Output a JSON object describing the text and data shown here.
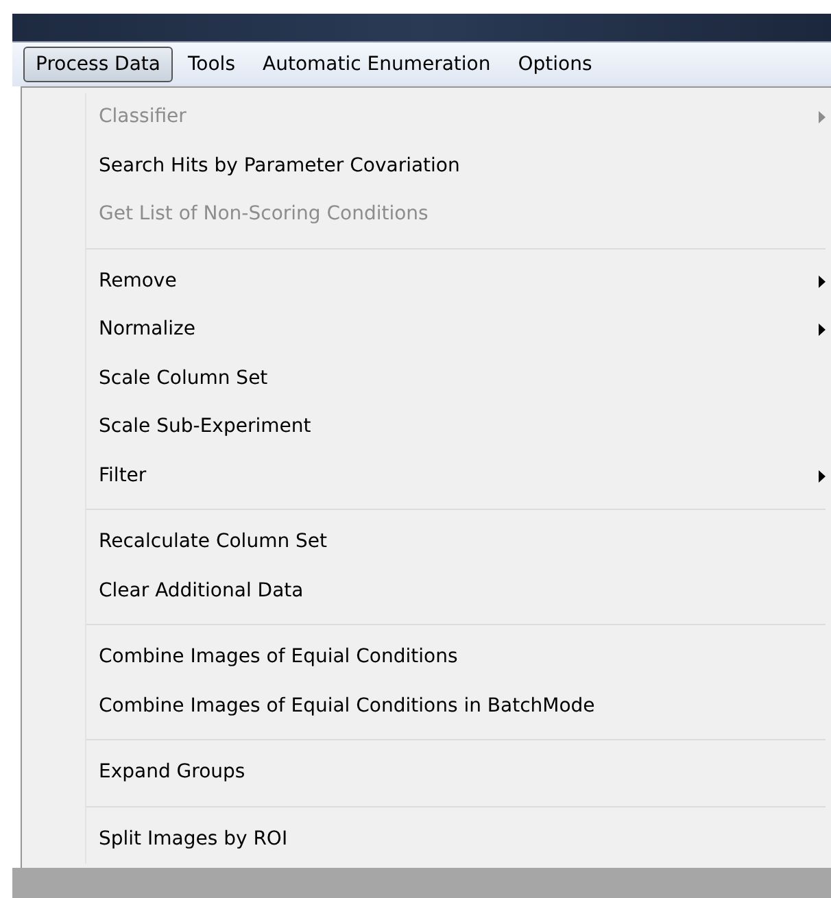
{
  "menubar": [
    {
      "label": "Process Data",
      "selected": true
    },
    {
      "label": "Tools",
      "selected": false
    },
    {
      "label": "Automatic Enumeration",
      "selected": false
    },
    {
      "label": "Options",
      "selected": false
    }
  ],
  "menu": {
    "groups": [
      {
        "items": [
          {
            "label": "Classifier",
            "disabled": true,
            "submenu": true
          },
          {
            "label": "Search Hits by Parameter Covariation",
            "disabled": false,
            "submenu": false
          },
          {
            "label": "Get List of Non-Scoring Conditions",
            "disabled": true,
            "submenu": false
          }
        ]
      },
      {
        "items": [
          {
            "label": "Remove",
            "disabled": false,
            "submenu": true
          },
          {
            "label": "Normalize",
            "disabled": false,
            "submenu": true
          },
          {
            "label": "Scale Column Set",
            "disabled": false,
            "submenu": false
          },
          {
            "label": "Scale Sub-Experiment",
            "disabled": false,
            "submenu": false
          },
          {
            "label": "Filter",
            "disabled": false,
            "submenu": true
          }
        ]
      },
      {
        "items": [
          {
            "label": "Recalculate Column Set",
            "disabled": false,
            "submenu": false
          },
          {
            "label": "Clear Additional Data",
            "disabled": false,
            "submenu": false
          }
        ]
      },
      {
        "items": [
          {
            "label": "Combine Images of Equial Conditions",
            "disabled": false,
            "submenu": false
          },
          {
            "label": "Combine Images of Equial Conditions in BatchMode",
            "disabled": false,
            "submenu": false
          }
        ]
      },
      {
        "items": [
          {
            "label": "Expand Groups",
            "disabled": false,
            "submenu": false
          }
        ]
      },
      {
        "items": [
          {
            "label": "Split Images by ROI",
            "disabled": false,
            "submenu": false
          }
        ]
      }
    ]
  }
}
